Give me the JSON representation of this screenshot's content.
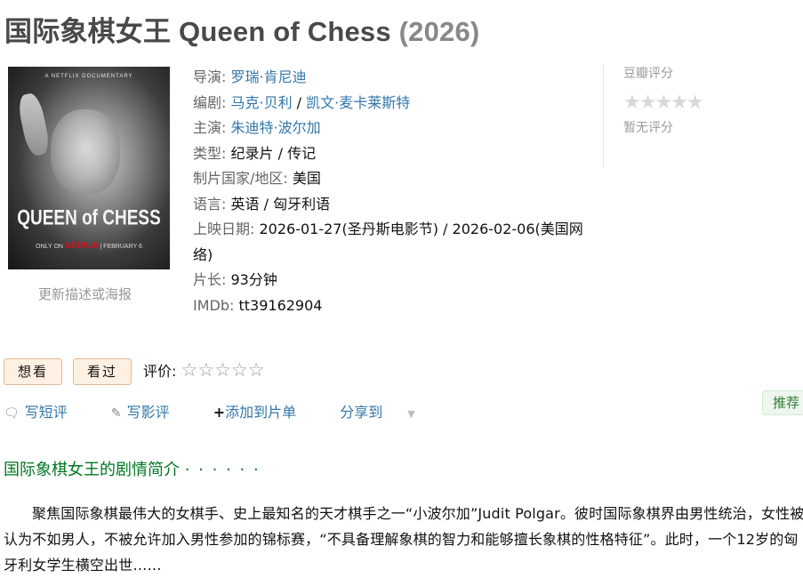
{
  "title": {
    "main": "国际象棋女王 Queen of Chess",
    "year": "(2026)"
  },
  "poster": {
    "top_text": "A NETFLIX DOCUMENTARY",
    "name": "QUEEN of CHESS",
    "only_on": "ONLY ON",
    "netflix": "NETFLIX",
    "date": "| FEBRUARY 6"
  },
  "update_poster": "更新描述或海报",
  "info": {
    "director": {
      "label": "导演",
      "values": [
        "罗瑞·肯尼迪"
      ]
    },
    "writer": {
      "label": "编剧",
      "values": [
        "马克·贝利",
        "凯文·麦卡莱斯特"
      ]
    },
    "cast": {
      "label": "主演",
      "values": [
        "朱迪特·波尔加"
      ]
    },
    "genre": {
      "label": "类型:",
      "value": "纪录片 / 传记"
    },
    "country": {
      "label": "制片国家/地区:",
      "value": "美国"
    },
    "language": {
      "label": "语言:",
      "value": "英语 / 匈牙利语"
    },
    "release": {
      "label": "上映日期:",
      "value": "2026-01-27(圣丹斯电影节) / 2026-02-06(美国网络)"
    },
    "runtime": {
      "label": "片长:",
      "value": "93分钟"
    },
    "imdb": {
      "label": "IMDb:",
      "value": "tt39162904"
    }
  },
  "rating": {
    "title": "豆瓣评分",
    "stars": "★★★★★",
    "none_text": "暂无评分"
  },
  "actions": {
    "want": "想看",
    "seen": "看过",
    "rate_label": "评价:",
    "rate_stars": "☆☆☆☆☆",
    "write_short": "写短评",
    "write_review": "写影评",
    "add_list": "添加到片单",
    "share": "分享到",
    "recommend": "推荐"
  },
  "summary": {
    "title": "国际象棋女王的剧情简介",
    "dots": "· · · · · ·",
    "text": "聚焦国际象棋最伟大的女棋手、史上最知名的天才棋手之一“小波尔加”Judit Polgar。彼时国际象棋界由男性统治，女性被认为不如男人，不被允许加入男性参加的锦标赛，“不具备理解象棋的智力和能够擅长象棋的性格特征”。此时，一个12岁的匈牙利女学生横空出世……"
  },
  "colors": {
    "link": "#3377aa",
    "section": "#007722",
    "button_bg": "#fff0e2"
  }
}
